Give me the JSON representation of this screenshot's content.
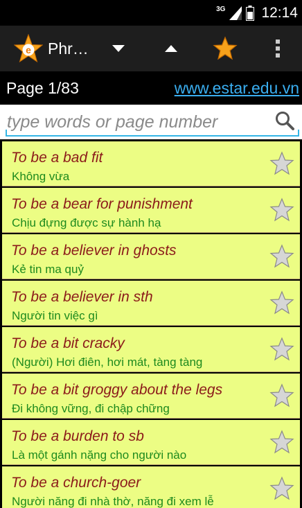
{
  "status_bar": {
    "network_label": "3G",
    "time": "12:14"
  },
  "action_bar": {
    "app_title": "Phr…",
    "icons": [
      "app-logo-icon",
      "chevron-down-icon",
      "chevron-up-icon",
      "star-icon",
      "overflow-menu-icon"
    ],
    "star_color": "#f7a21b"
  },
  "info_bar": {
    "page_label": "Page 1/83",
    "website": "www.estar.edu.vn"
  },
  "search": {
    "placeholder": "type words or page number",
    "value": ""
  },
  "colors": {
    "row_background": "#ecfd84",
    "phrase": "#8b1a1a",
    "meaning": "#1e8a1e",
    "link": "#3aaef0"
  },
  "entries": [
    {
      "phrase": "To be a bad fit",
      "meaning": "Không vừa"
    },
    {
      "phrase": "To be a bear for punishment",
      "meaning": "Chịu đựng được sự hành hạ"
    },
    {
      "phrase": "To be a believer in ghosts",
      "meaning": "Kẻ tin ma quỷ"
    },
    {
      "phrase": "To be a believer in sth",
      "meaning": "Người tin việc gì"
    },
    {
      "phrase": "To be a bit cracky",
      "meaning": "(Người) Hơi điên, hơi mát, tàng tàng"
    },
    {
      "phrase": "To be a bit groggy about the legs",
      "meaning": "Đi không vững, đi chập chững"
    },
    {
      "phrase": "To be a burden to sb",
      "meaning": "Là một gánh nặng cho người nào"
    },
    {
      "phrase": "To be a church-goer",
      "meaning": "Người năng đi nhà thờ, năng đi xem lễ"
    }
  ]
}
